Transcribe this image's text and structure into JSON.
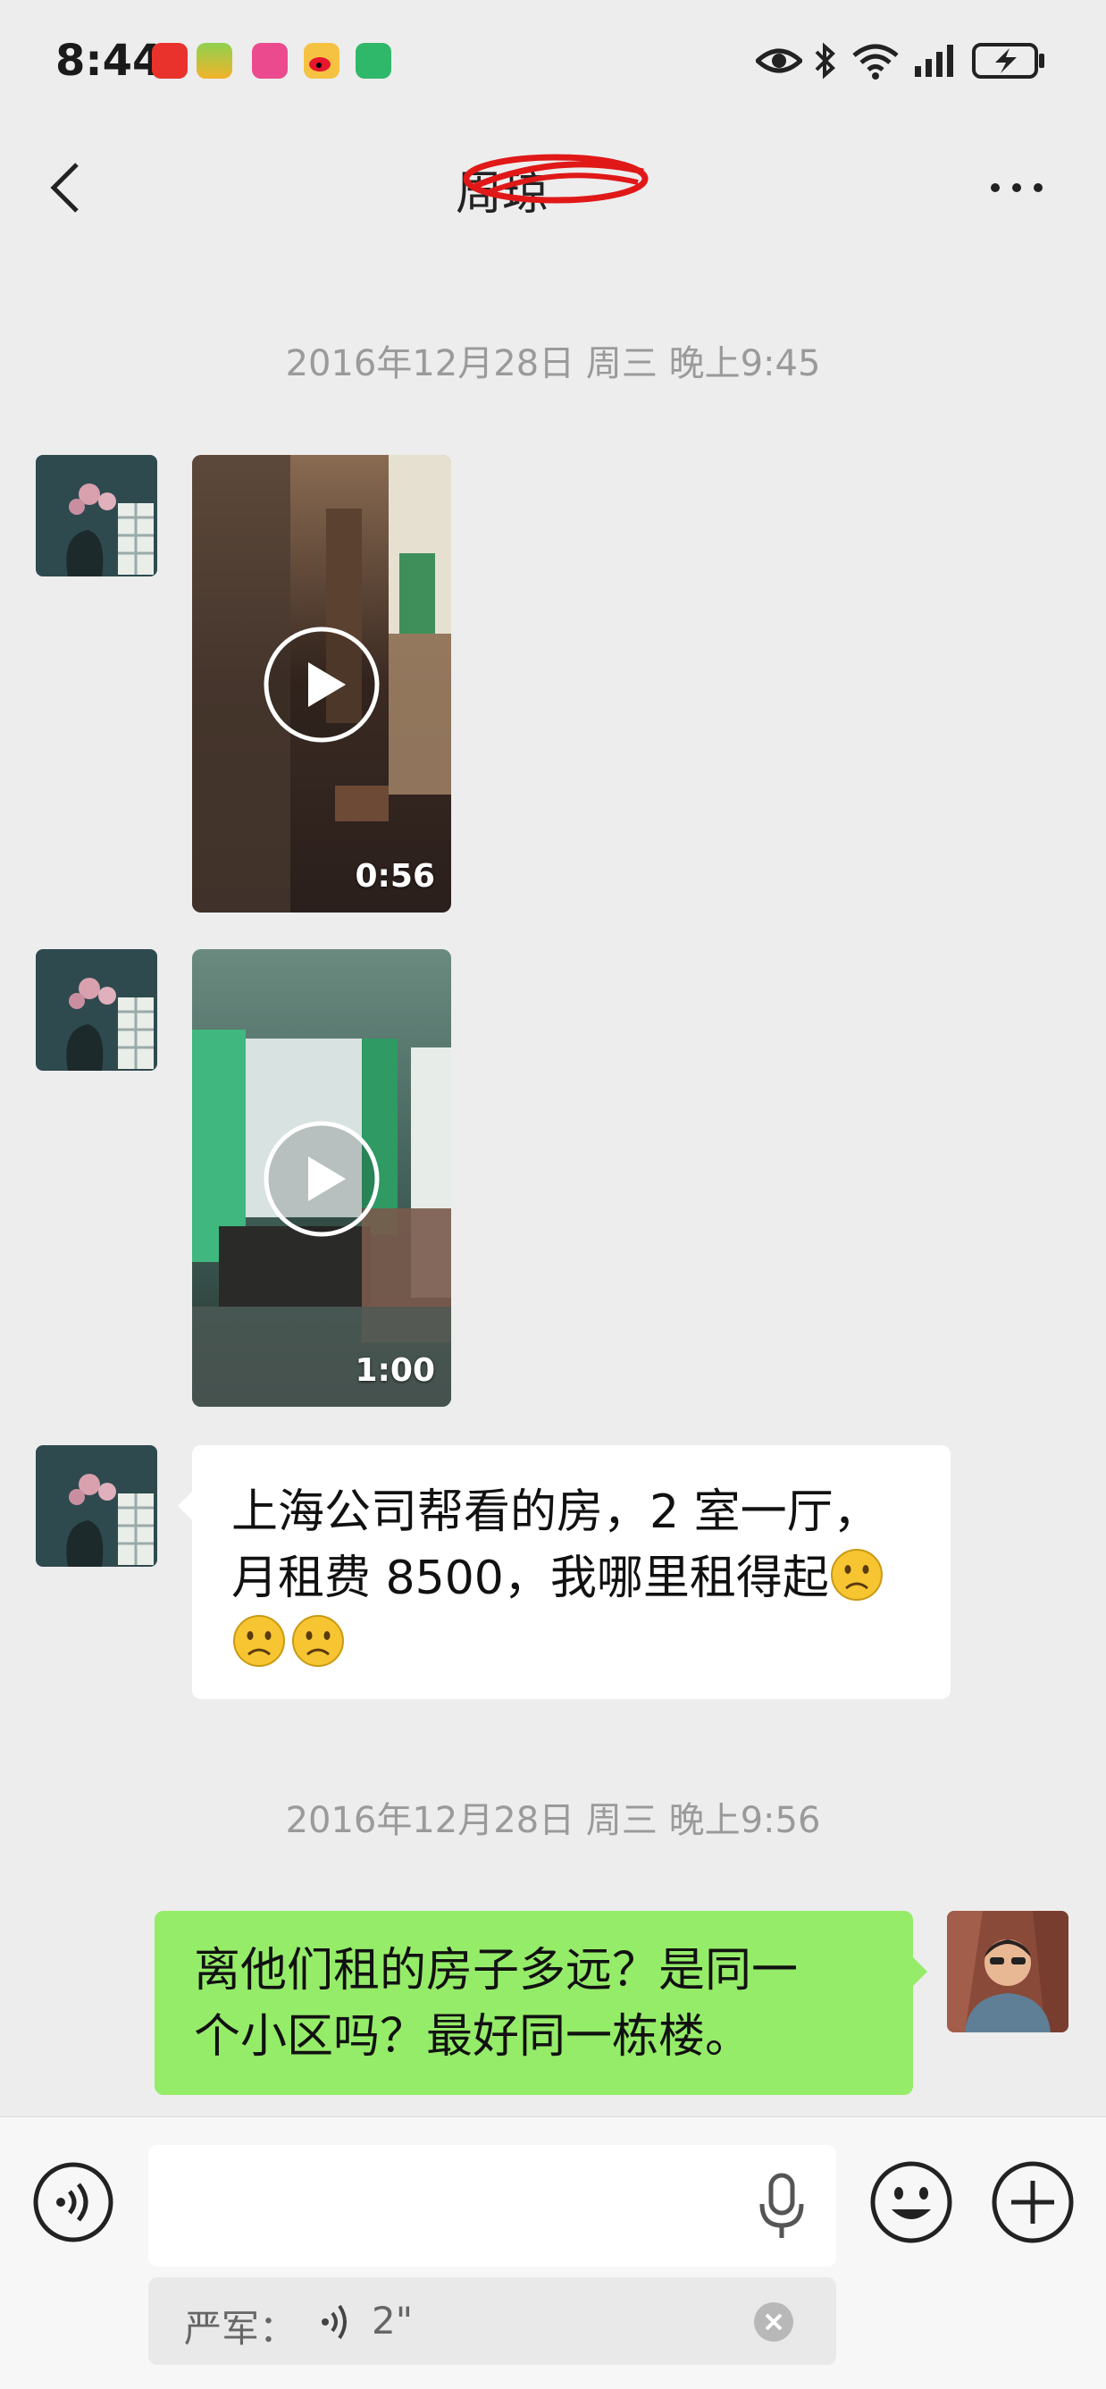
{
  "status_bar": {
    "time": "8:44",
    "app_icons": [
      "huawei-app-icon",
      "game-app-icon",
      "pink-app-icon",
      "weibo-icon",
      "wifi-app-icon"
    ],
    "system_icons": [
      "eye-icon",
      "bluetooth-icon",
      "wifi-icon",
      "signal-icon",
      "battery-charging-icon"
    ]
  },
  "header": {
    "title": "周琼"
  },
  "messages": [
    {
      "type": "timestamp",
      "text": "2016年12月28日 周三 晚上9:45"
    },
    {
      "type": "video",
      "from": "other",
      "duration": "0:56"
    },
    {
      "type": "video",
      "from": "other",
      "duration": "1:00"
    },
    {
      "type": "text",
      "from": "other",
      "lines": [
        "上海公司帮看的房，2 室一厅，",
        "月租费 8500，我哪里租得起"
      ],
      "emoji": [
        "frown",
        "frown",
        "frown"
      ]
    },
    {
      "type": "timestamp",
      "text": "2016年12月28日 周三 晚上9:56"
    },
    {
      "type": "text",
      "from": "me",
      "lines": [
        "离他们租的房子多远？是同一",
        "个小区吗？最好同一栋楼。"
      ]
    }
  ],
  "input_bar": {
    "quote_text": "严军：",
    "quote_voice": "2\""
  },
  "colors": {
    "background": "#ededed",
    "bubble_me": "#95ec69",
    "bubble_other": "#ffffff",
    "timestamp": "#9a9a9a"
  }
}
